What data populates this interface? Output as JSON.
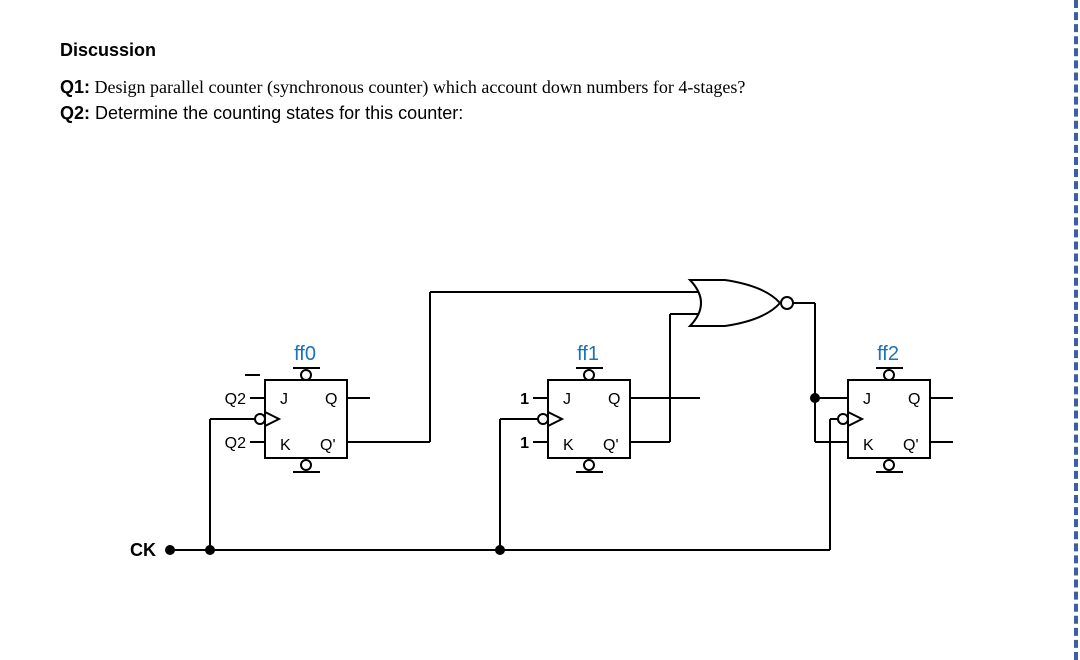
{
  "heading": "Discussion",
  "q1": {
    "label": "Q1:",
    "text": "Design parallel counter (synchronous counter) which account down numbers for 4-stages?"
  },
  "q2": {
    "label": "Q2:",
    "text": "Determine the counting states for this counter:"
  },
  "clock_label": "CK",
  "ff": [
    {
      "name": "ff0",
      "j_input": "Q2",
      "k_input": "Q2",
      "q": "Q",
      "qbar": "Q'",
      "j": "J",
      "k": "K"
    },
    {
      "name": "ff1",
      "j_input": "1",
      "k_input": "1",
      "q": "Q",
      "qbar": "Q'",
      "j": "J",
      "k": "K"
    },
    {
      "name": "ff2",
      "j_input": "",
      "k_input": "",
      "q": "Q",
      "qbar": "Q'",
      "j": "J",
      "k": "K"
    }
  ],
  "gate": {
    "type": "NOR"
  }
}
